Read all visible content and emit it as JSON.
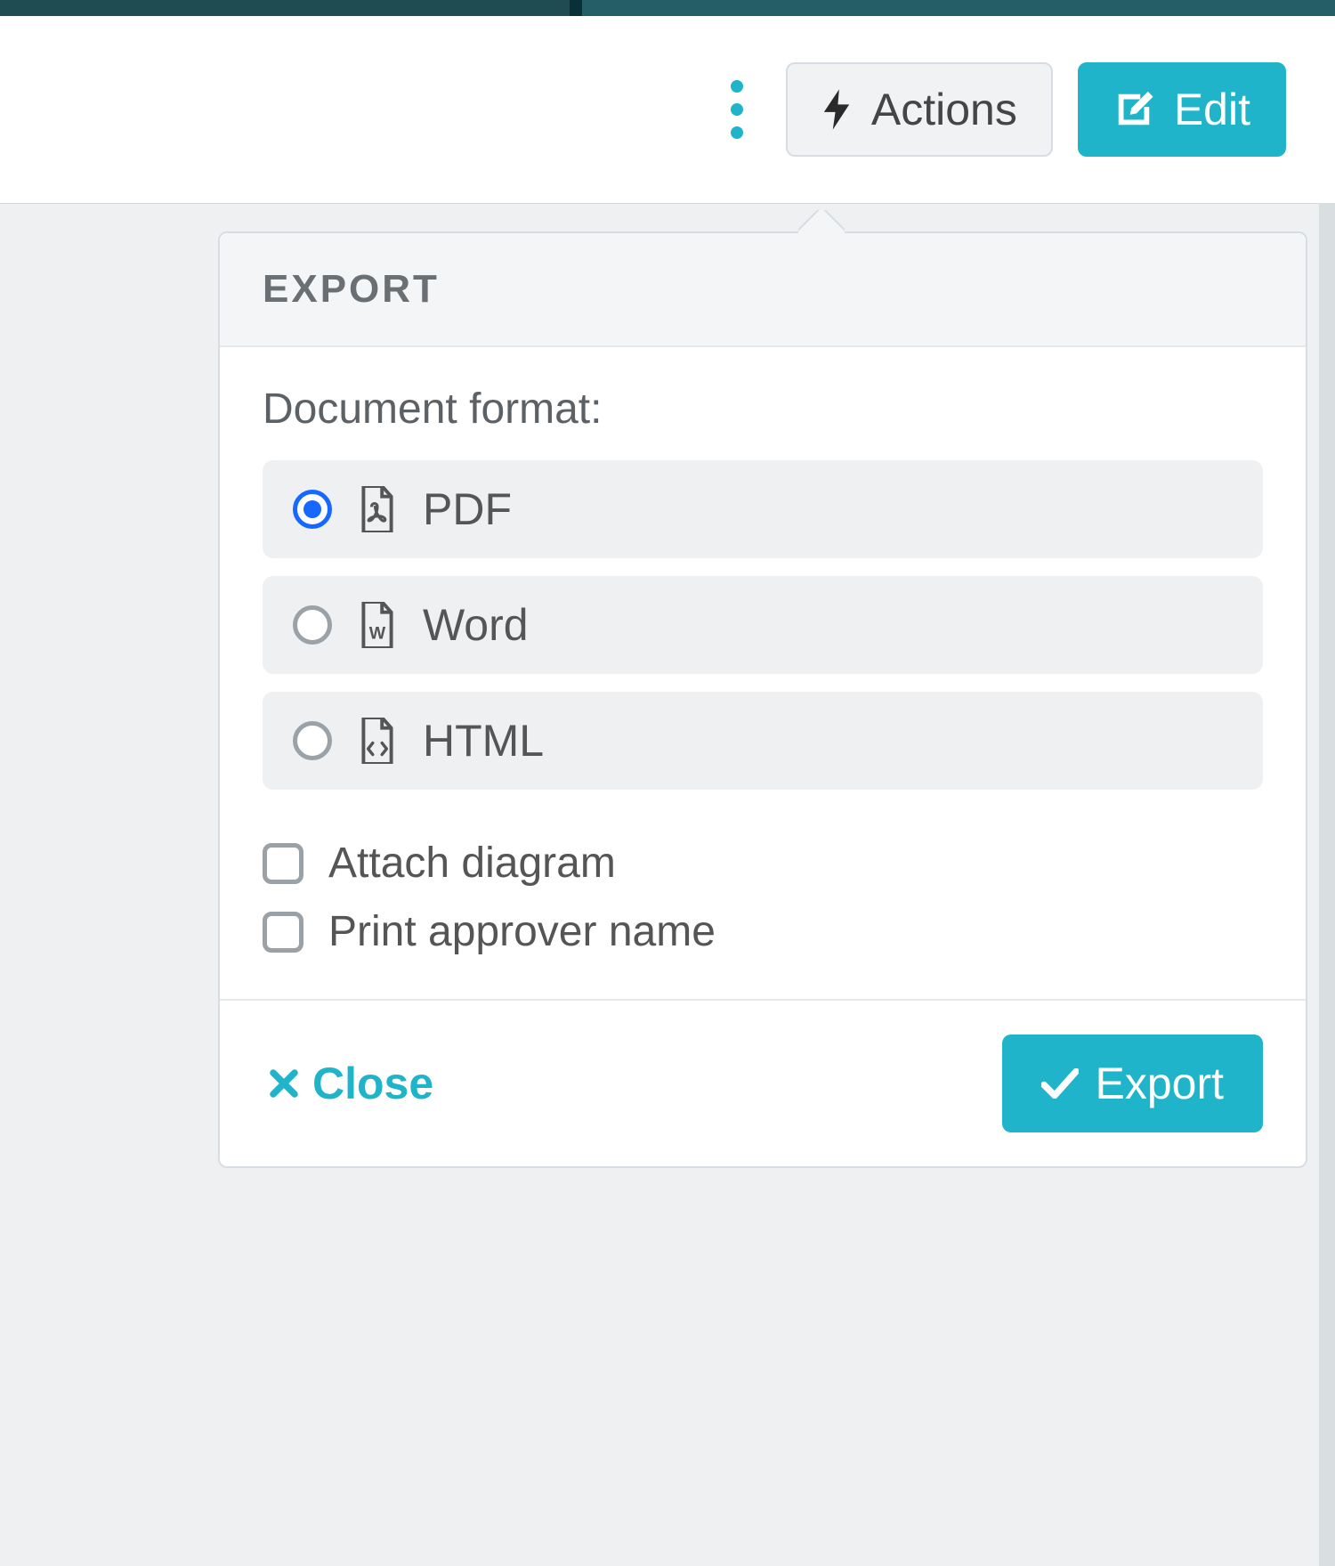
{
  "header": {
    "actions_label": "Actions",
    "edit_label": "Edit"
  },
  "popover": {
    "title": "EXPORT",
    "format_label": "Document format:",
    "formats": [
      {
        "label": "PDF",
        "selected": true
      },
      {
        "label": "Word",
        "selected": false
      },
      {
        "label": "HTML",
        "selected": false
      }
    ],
    "options": [
      {
        "label": "Attach diagram",
        "checked": false
      },
      {
        "label": "Print approver name",
        "checked": false
      }
    ],
    "close_label": "Close",
    "export_label": "Export"
  },
  "colors": {
    "accent": "#1fb4c9",
    "radio_selected": "#1668ff"
  }
}
